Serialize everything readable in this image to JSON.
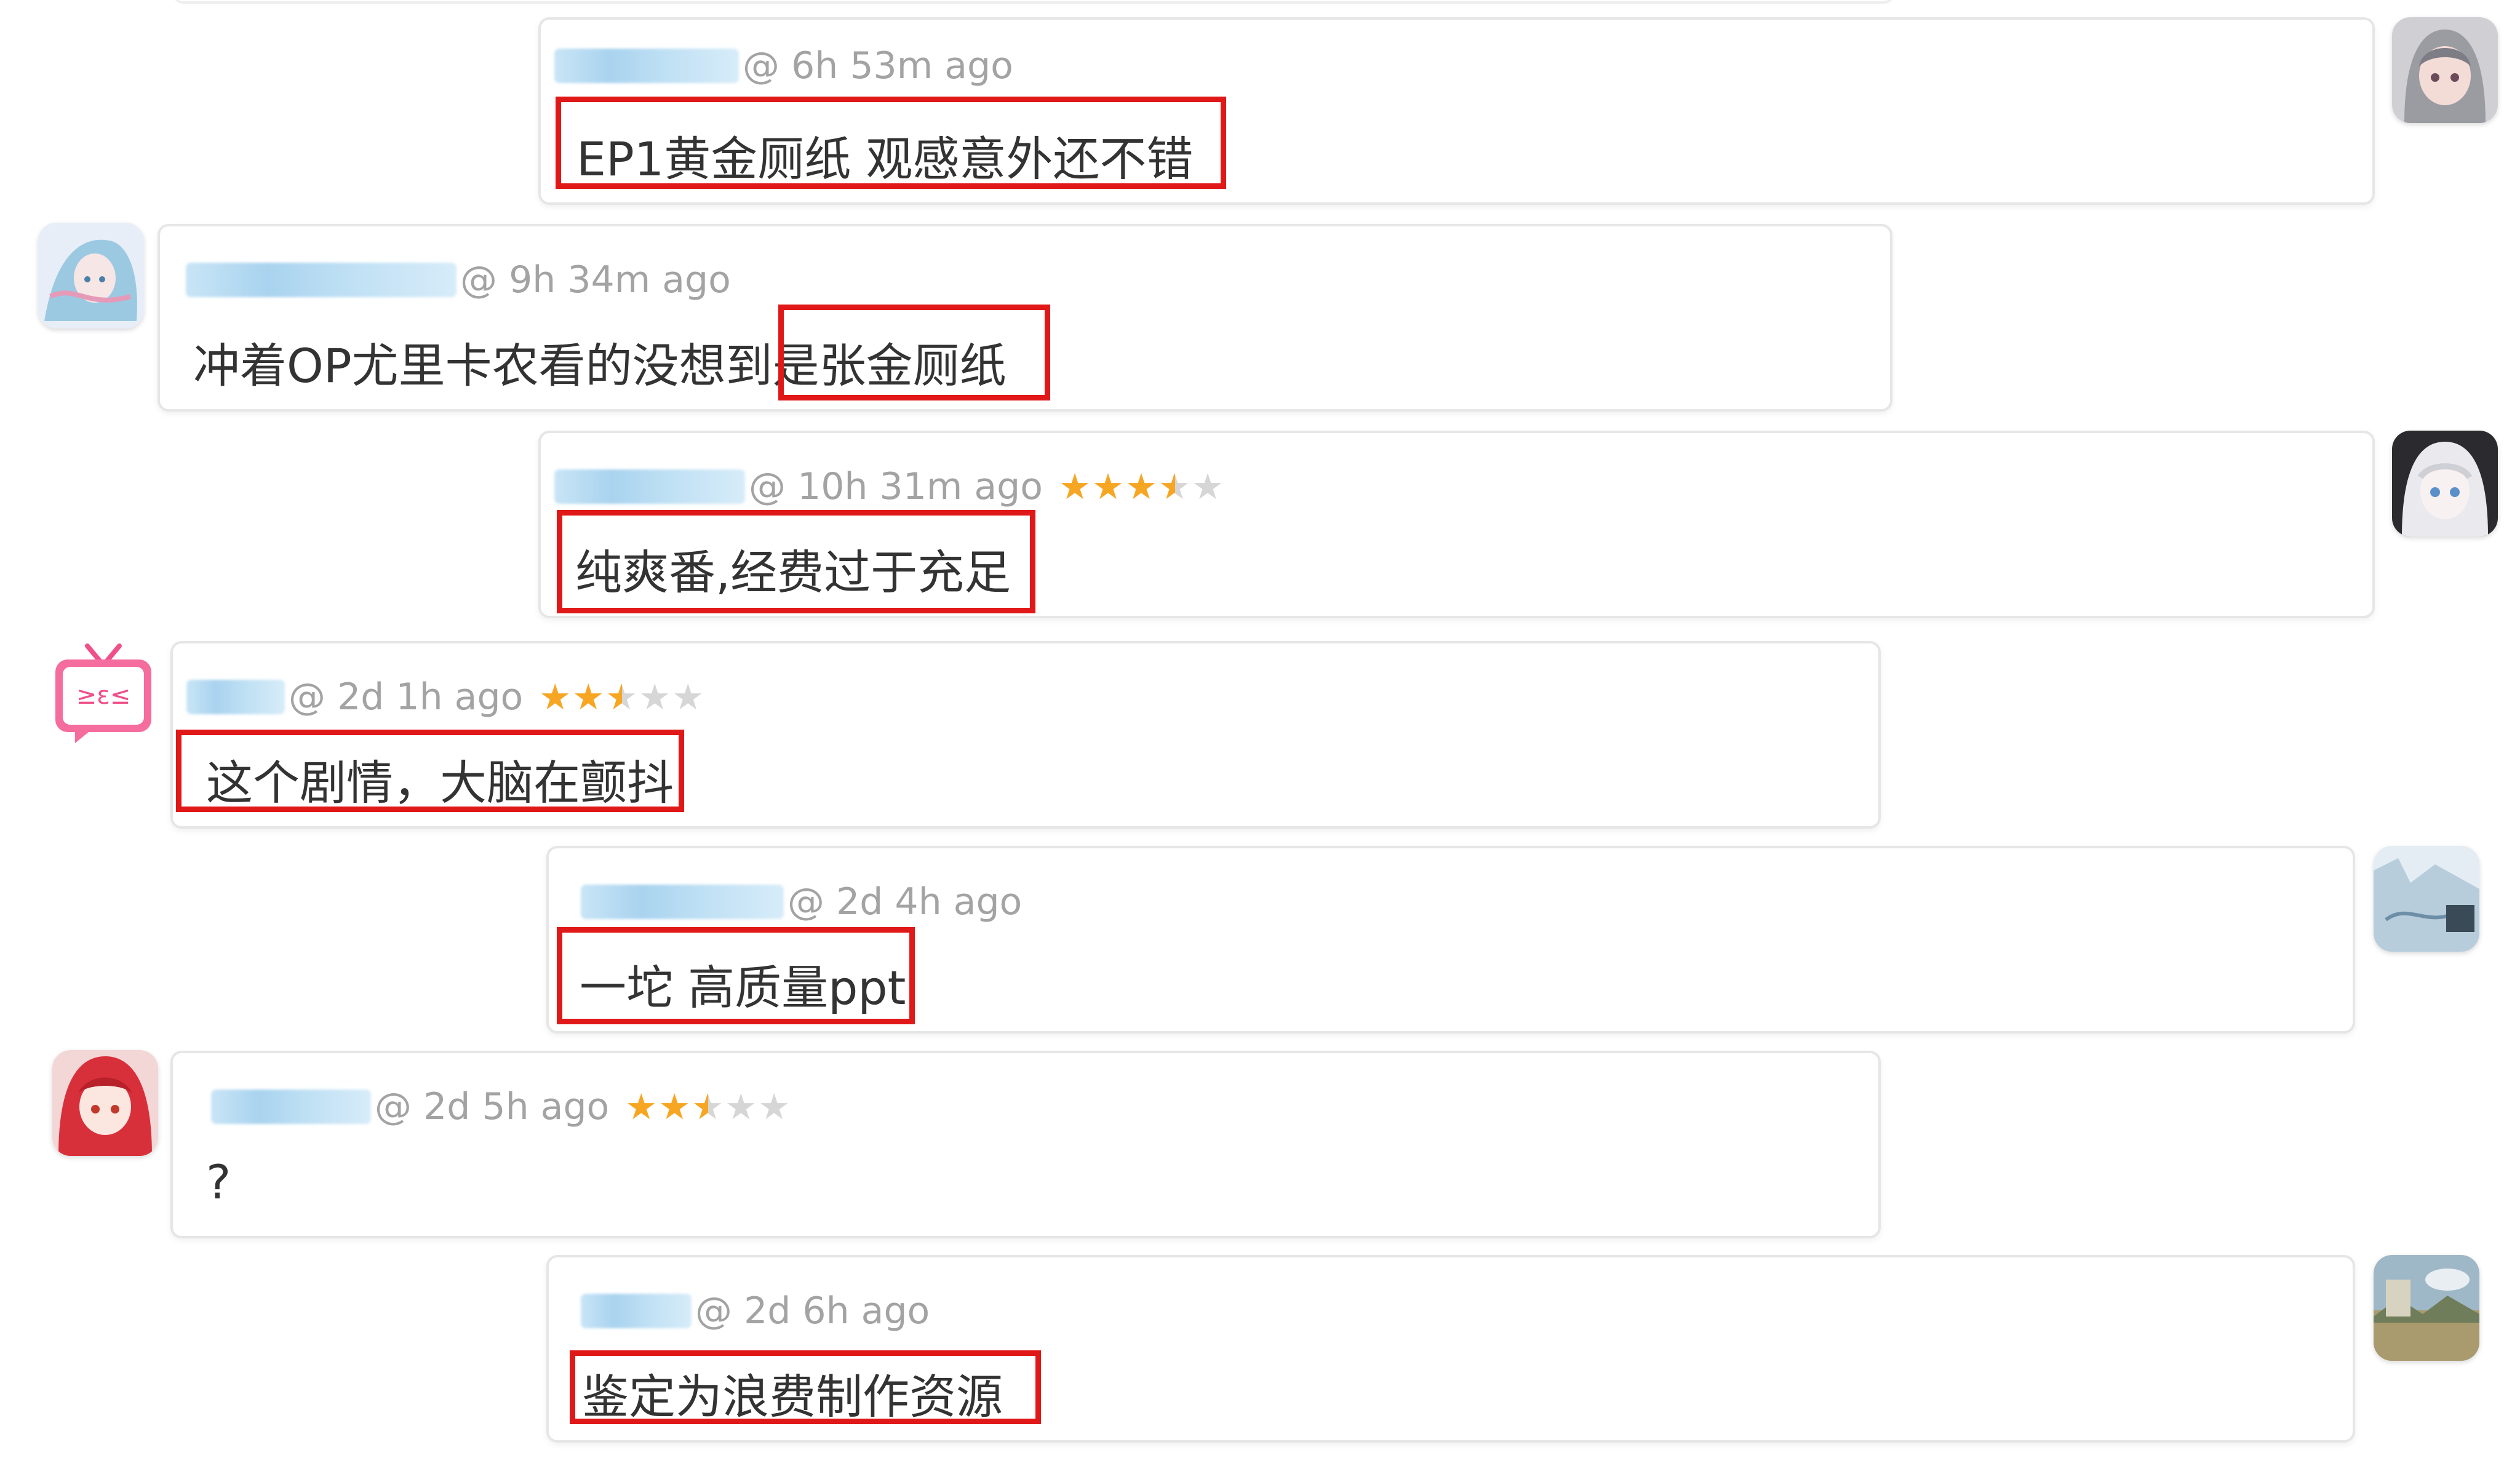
{
  "comments": [
    {
      "time": "@ 6h 53m ago",
      "text": "EP1黄金厕纸 观感意外还不错",
      "rating": null,
      "avatar_icon": "anime-girl-gray-hair-avatar-icon"
    },
    {
      "time": "@ 9h 34m ago",
      "text_before": "冲着OP尤里卡农看的没想到",
      "text_highlight": "是张金厕纸",
      "rating": null,
      "avatar_icon": "anime-miku-avatar-icon"
    },
    {
      "time": "@ 10h 31m ago",
      "text": "纯爽番,经费过于充足",
      "rating": 3.5,
      "avatar_icon": "anime-white-hair-avatar-icon"
    },
    {
      "time": "@ 2d 1h ago",
      "text": "这个剧情，大脑在颤抖",
      "rating": 2.5,
      "avatar_icon": "pink-tv-face-avatar-icon",
      "avatar_face": "≥ε≤"
    },
    {
      "time": "@ 2d 4h ago",
      "text": "一坨 高质量ppt",
      "rating": null,
      "avatar_icon": "sketch-poster-avatar-icon"
    },
    {
      "time": "@ 2d 5h ago",
      "text": "?",
      "rating": 2.5,
      "avatar_icon": "red-hair-girl-avatar-icon"
    },
    {
      "time": "@ 2d 6h ago",
      "text": "鉴定为浪费制作资源",
      "rating": null,
      "avatar_icon": "landscape-painting-avatar-icon"
    }
  ],
  "colors": {
    "highlight": "#e01818",
    "star": "#f6a623",
    "meta": "#a3a3a3"
  }
}
